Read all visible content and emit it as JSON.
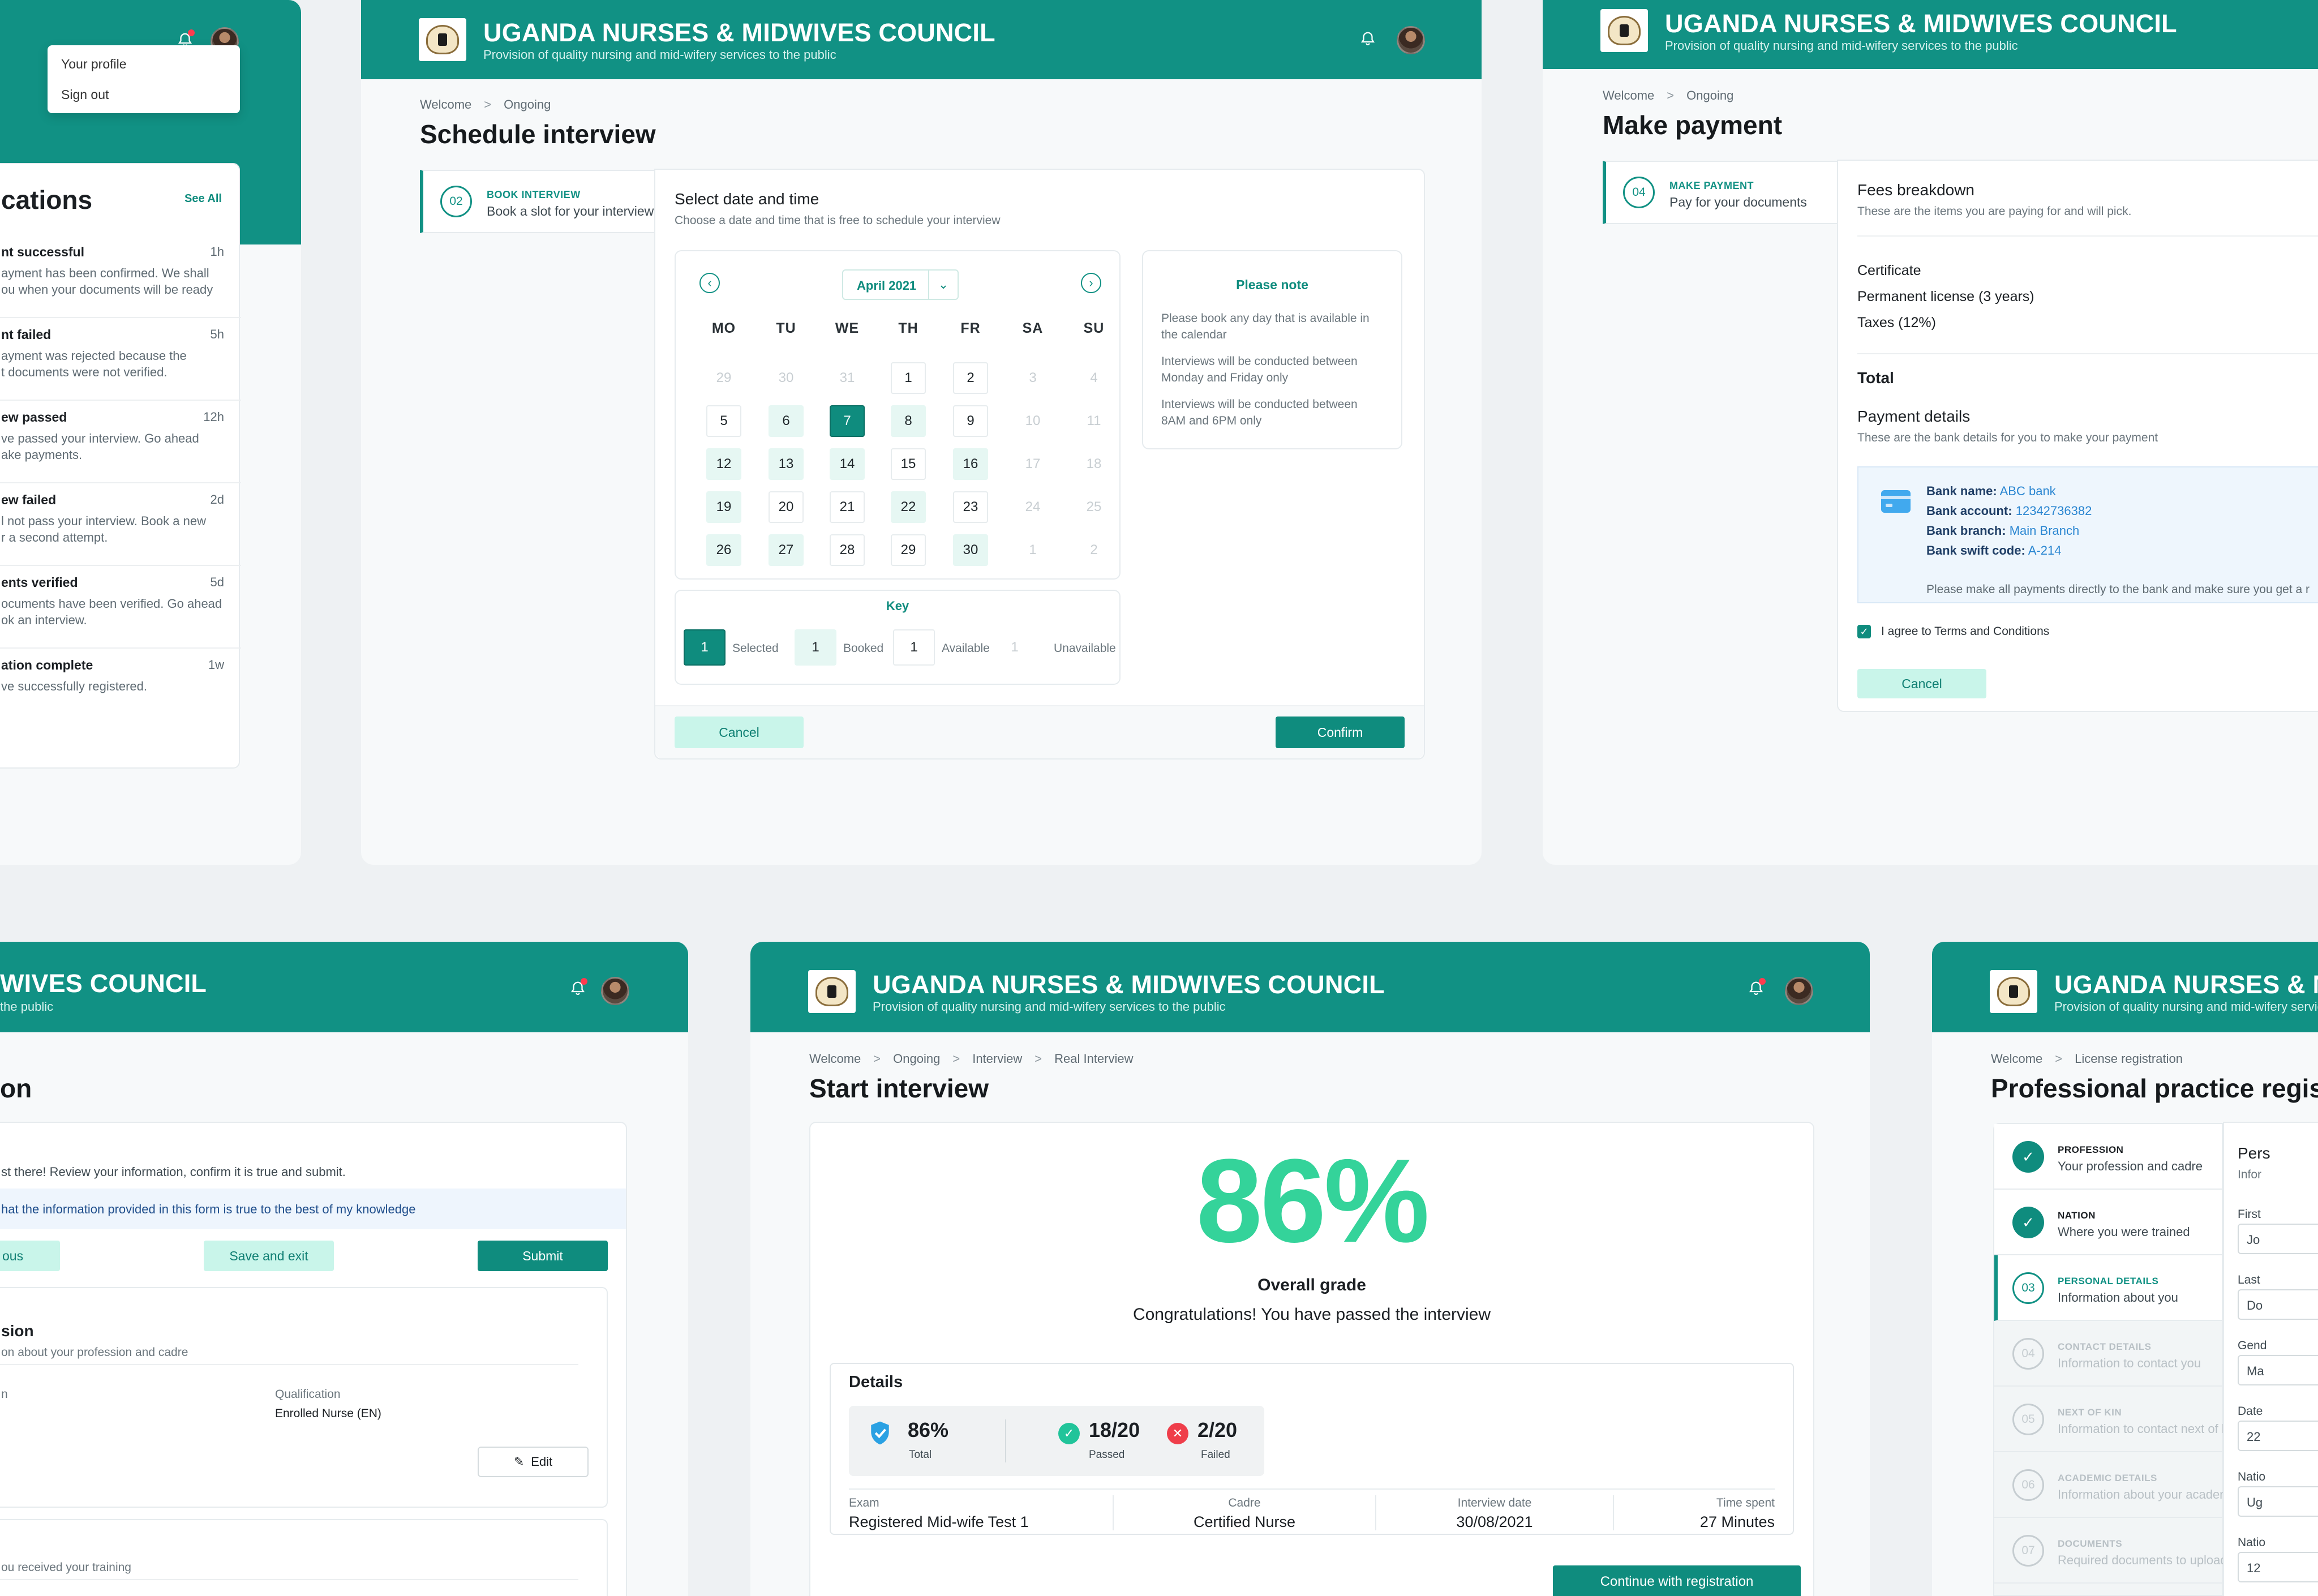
{
  "brand": {
    "title": "UGANDA NURSES & MIDWIVES COUNCIL",
    "subtitle": "Provision of quality nursing and mid-wifery services to the public",
    "title_partial": "WIVES COUNCIL",
    "subtitle_partial": "the public",
    "title_partial_right": "UGANDA NURSES & M",
    "subtitle_partial_right": "Provision of quality nursing and mid-wifery servic",
    "color_primary": "#119184",
    "color_accent": "#34d39a"
  },
  "notifications_panel": {
    "menu": [
      "Your profile",
      "Sign out"
    ],
    "title": "cations",
    "see_all": "See All",
    "items": [
      {
        "title": "nt successful",
        "time": "1h",
        "lines": [
          "ayment has been confirmed. We shall",
          "ou when your documents will be ready"
        ]
      },
      {
        "title": "nt failed",
        "time": "5h",
        "lines": [
          "ayment was rejected because the",
          "t documents were not verified."
        ]
      },
      {
        "title": "ew passed",
        "time": "12h",
        "lines": [
          "ve passed your interview. Go ahead",
          "ake payments."
        ]
      },
      {
        "title": "ew failed",
        "time": "2d",
        "lines": [
          "l not pass your interview. Book a new",
          "r a second attempt."
        ]
      },
      {
        "title": "ents verified",
        "time": "5d",
        "lines": [
          "ocuments have been verified. Go ahead",
          "ok an interview."
        ]
      },
      {
        "title": "ation complete",
        "time": "1w",
        "lines": [
          "ve successfully registered."
        ]
      }
    ]
  },
  "schedule": {
    "breadcrumb": [
      "Welcome",
      "Ongoing"
    ],
    "title": "Schedule interview",
    "step": {
      "number": "02",
      "title": "BOOK INTERVIEW",
      "desc": "Book a slot for your interview"
    },
    "section_title": "Select date and time",
    "section_desc": "Choose a date and time that is free to schedule your interview",
    "month": "April 2021",
    "weekdays": [
      "MO",
      "TU",
      "WE",
      "TH",
      "FR",
      "SA",
      "SU"
    ],
    "weeks": [
      [
        "29",
        "30",
        "31",
        "1",
        "2",
        "3",
        "4"
      ],
      [
        "5",
        "6",
        "7",
        "8",
        "9",
        "10",
        "11"
      ],
      [
        "12",
        "13",
        "14",
        "15",
        "16",
        "17",
        "18"
      ],
      [
        "19",
        "20",
        "21",
        "22",
        "23",
        "24",
        "25"
      ],
      [
        "26",
        "27",
        "28",
        "29",
        "30",
        "1",
        "2"
      ]
    ],
    "states": [
      [
        "u",
        "u",
        "u",
        "a",
        "a",
        "u",
        "u"
      ],
      [
        "a",
        "b",
        "s",
        "b",
        "a",
        "u",
        "u"
      ],
      [
        "b",
        "b",
        "b",
        "a",
        "b",
        "u",
        "u"
      ],
      [
        "b",
        "a",
        "a",
        "b",
        "a",
        "u",
        "u"
      ],
      [
        "b",
        "b",
        "a",
        "a",
        "b",
        "u",
        "u"
      ]
    ],
    "note_title": "Please note",
    "notes": [
      [
        "Please book any day that is available in",
        "the calendar"
      ],
      [
        "Interviews will be conducted between",
        "Monday and  Friday only"
      ],
      [
        "Interviews will be conducted between",
        "8AM and 6PM only"
      ]
    ],
    "key_title": "Key",
    "key": [
      {
        "num": "1",
        "label": "Selected"
      },
      {
        "num": "1",
        "label": "Booked"
      },
      {
        "num": "1",
        "label": "Available"
      },
      {
        "num": "1",
        "label": "Unavailable"
      }
    ],
    "cancel": "Cancel",
    "confirm": "Confirm"
  },
  "payment": {
    "breadcrumb": [
      "Welcome",
      "Ongoing"
    ],
    "title": "Make payment",
    "step": {
      "number": "04",
      "title": "MAKE PAYMENT",
      "desc": "Pay for your documents"
    },
    "fees_title": "Fees breakdown",
    "fees_desc": "These are the items you are paying for and will pick.",
    "fees": [
      "Certificate",
      "Permanent license (3 years)",
      "Taxes (12%)"
    ],
    "total_label": "Total",
    "pd_title": "Payment details",
    "pd_desc": "These are the bank details for you to make your payment",
    "bank": [
      {
        "k": "Bank name:",
        "v": "ABC bank"
      },
      {
        "k": "Bank account:",
        "v": "12342736382"
      },
      {
        "k": "Bank branch:",
        "v": "Main Branch"
      },
      {
        "k": "Bank swift code:",
        "v": "A-214"
      }
    ],
    "bank_note": "Please make all payments directly to the bank and make sure you get a r",
    "agree": "I agree to Terms and Conditions",
    "cancel": "Cancel"
  },
  "review": {
    "title": "on",
    "intro": "st there! Review your information, confirm it is true and submit.",
    "declaration": "hat the information provided in this form is true to the best of my knowledge",
    "previous": "ous",
    "save_exit": "Save and exit",
    "submit": "Submit",
    "section_title": "sion",
    "section_desc": "on about your profession and cadre",
    "field_left": "n",
    "qual_label": "Qualification",
    "qual_value": "Enrolled Nurse (EN)",
    "edit": "Edit",
    "section2_desc": "ou received your training"
  },
  "interview": {
    "breadcrumb": [
      "Welcome",
      "Ongoing",
      "Interview",
      "Real Interview"
    ],
    "title": "Start interview",
    "score": "86%",
    "grade_label": "Overall grade",
    "congrats": "Congratulations! You have passed the interview",
    "details_title": "Details",
    "total": "86%",
    "total_label": "Total",
    "passed": "18/20",
    "passed_label": "Passed",
    "failed": "2/20",
    "failed_label": "Failed",
    "meta": [
      {
        "label": "Exam",
        "value": "Registered Mid-wife Test 1"
      },
      {
        "label": "Cadre",
        "value": "Certified Nurse"
      },
      {
        "label": "Interview date",
        "value": "30/08/2021"
      },
      {
        "label": "Time spent",
        "value": "27 Minutes"
      }
    ],
    "continue": "Continue with registration"
  },
  "registration": {
    "breadcrumb": [
      "Welcome",
      "License  registration"
    ],
    "title": "Professional practice regist",
    "steps": [
      {
        "number": "",
        "title": "PROFESSION",
        "desc": "Your profession and cadre",
        "state": "done"
      },
      {
        "number": "",
        "title": "NATION",
        "desc": "Where you were trained",
        "state": "done"
      },
      {
        "number": "03",
        "title": "PERSONAL DETAILS",
        "desc": "Information about you",
        "state": "active"
      },
      {
        "number": "04",
        "title": "CONTACT DETAILS",
        "desc": "Information to contact you",
        "state": "todo"
      },
      {
        "number": "05",
        "title": "NEXT OF KIN",
        "desc": "Information to contact next of kin",
        "state": "todo"
      },
      {
        "number": "06",
        "title": "ACADEMIC DETAILS",
        "desc": "Information about your academics",
        "state": "todo"
      },
      {
        "number": "07",
        "title": "DOCUMENTS",
        "desc": "Required documents to upload",
        "state": "todo"
      }
    ],
    "form_title": "Pers",
    "form_desc": "Infor",
    "fields": [
      {
        "label": "First",
        "value": "Jo"
      },
      {
        "label": "Last",
        "value": "Do"
      },
      {
        "label": "Gend",
        "value": "Ma"
      },
      {
        "label": "Date",
        "value": "22"
      },
      {
        "label": "Natio",
        "value": "Ug"
      },
      {
        "label": "Natio",
        "value": "12"
      }
    ]
  }
}
